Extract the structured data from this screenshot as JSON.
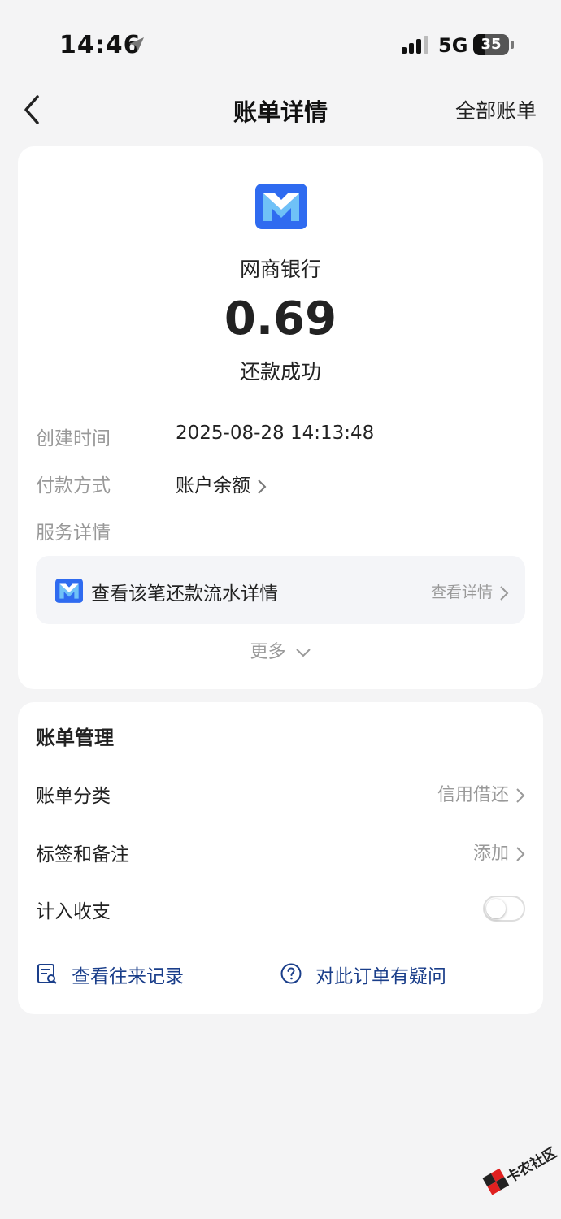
{
  "status_bar": {
    "time": "14:46",
    "network": "5G",
    "battery": "35",
    "battery_level": 0.35
  },
  "nav": {
    "title": "账单详情",
    "right_link": "全部账单"
  },
  "bill": {
    "merchant": "网商银行",
    "amount": "0.69",
    "status": "还款成功",
    "fields": [
      {
        "label": "创建时间",
        "value": "2025-08-28 14:13:48"
      },
      {
        "label": "付款方式",
        "value": "账户余额"
      },
      {
        "label": "服务详情",
        "value": ""
      }
    ],
    "service": {
      "text": "查看该笔还款流水详情",
      "link": "查看详情"
    },
    "more": "更多"
  },
  "management": {
    "title": "账单管理",
    "rows": [
      {
        "label": "账单分类",
        "value": "信用借还"
      },
      {
        "label": "标签和备注",
        "value": "添加"
      },
      {
        "label": "计入收支",
        "toggle": false
      }
    ],
    "actions": [
      {
        "label": "查看往来记录",
        "icon": "record-icon"
      },
      {
        "label": "对此订单有疑问",
        "icon": "question-icon"
      }
    ]
  },
  "watermark": {
    "text": "卡农社区"
  },
  "colors": {
    "brand_blue": "#2f6bf0",
    "action_blue": "#1a3e8a",
    "label_gray": "#999999",
    "background": "#f4f4f5"
  }
}
